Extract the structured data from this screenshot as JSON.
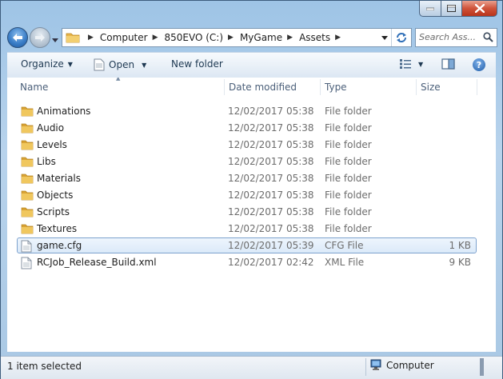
{
  "window": {
    "minimize_icon": "minimize-icon",
    "maximize_icon": "maximize-icon",
    "close_icon": "close-icon"
  },
  "nav": {
    "back_icon": "back-arrow-icon",
    "forward_icon": "forward-arrow-icon",
    "breadcrumb": [
      "Computer",
      "850EVO (C:)",
      "MyGame",
      "Assets"
    ],
    "search_placeholder": "Search Ass..."
  },
  "toolbar": {
    "organize_label": "Organize",
    "open_label": "Open",
    "new_folder_label": "New folder"
  },
  "columns": {
    "name": "Name",
    "date_modified": "Date modified",
    "type": "Type",
    "size": "Size"
  },
  "files": [
    {
      "name": "Animations",
      "date": "12/02/2017 05:38",
      "type": "File folder",
      "size": "",
      "kind": "folder"
    },
    {
      "name": "Audio",
      "date": "12/02/2017 05:38",
      "type": "File folder",
      "size": "",
      "kind": "folder"
    },
    {
      "name": "Levels",
      "date": "12/02/2017 05:38",
      "type": "File folder",
      "size": "",
      "kind": "folder"
    },
    {
      "name": "Libs",
      "date": "12/02/2017 05:38",
      "type": "File folder",
      "size": "",
      "kind": "folder"
    },
    {
      "name": "Materials",
      "date": "12/02/2017 05:38",
      "type": "File folder",
      "size": "",
      "kind": "folder"
    },
    {
      "name": "Objects",
      "date": "12/02/2017 05:38",
      "type": "File folder",
      "size": "",
      "kind": "folder"
    },
    {
      "name": "Scripts",
      "date": "12/02/2017 05:38",
      "type": "File folder",
      "size": "",
      "kind": "folder"
    },
    {
      "name": "Textures",
      "date": "12/02/2017 05:38",
      "type": "File folder",
      "size": "",
      "kind": "folder"
    },
    {
      "name": "game.cfg",
      "date": "12/02/2017 05:39",
      "type": "CFG File",
      "size": "1 KB",
      "kind": "file",
      "selected": true
    },
    {
      "name": "RCJob_Release_Build.xml",
      "date": "12/02/2017 02:42",
      "type": "XML File",
      "size": "9 KB",
      "kind": "file"
    }
  ],
  "status": {
    "selection_text": "1 item selected",
    "location_label": "Computer"
  },
  "colors": {
    "frame": "#a9c8e4",
    "selection_border": "#7da2ce",
    "folder": "#e8b54a",
    "command_text": "#1e3952"
  }
}
